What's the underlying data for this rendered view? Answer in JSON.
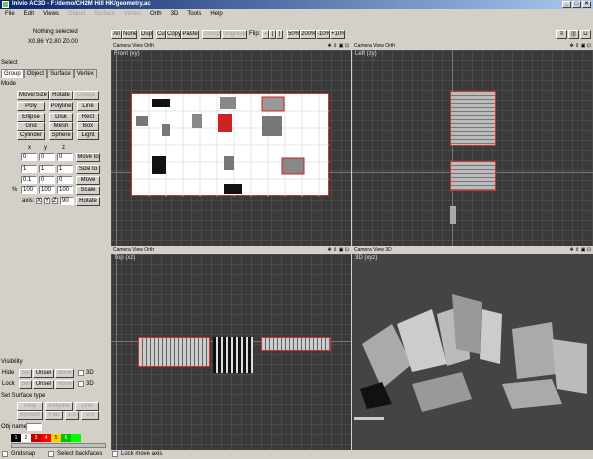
{
  "window": {
    "title": "Inivio AC3D - F:/demo/CH2M Hill HK/geometry.ac",
    "btn_min": "_",
    "btn_max": "□",
    "btn_close": "×"
  },
  "menu": [
    {
      "label": "File",
      "disabled": false
    },
    {
      "label": "Edit",
      "disabled": false
    },
    {
      "label": "Views",
      "disabled": false
    },
    {
      "label": "Object",
      "disabled": true
    },
    {
      "label": "Surface",
      "disabled": true
    },
    {
      "label": "Vertex",
      "disabled": true
    },
    {
      "label": "Orth",
      "disabled": false
    },
    {
      "label": "3D",
      "disabled": false
    },
    {
      "label": "Tools",
      "disabled": false
    },
    {
      "label": "Help",
      "disabled": false
    }
  ],
  "toolbar": {
    "all": "All",
    "none": "None",
    "dup": "Dup",
    "cut": "Cut",
    "copy": "Copy",
    "paste": "Paste",
    "group": "Group",
    "ungroup": "Ungroup",
    "flip": "Flip:",
    "flipx": "-",
    "flipy": "|",
    "flipz": "|",
    "zoom50": "50%",
    "zoom200": "200%",
    "zoomm10": "-10%",
    "zoomp10": "+10%",
    "r1": "≡",
    "r2": "|||",
    "r3": "⊔"
  },
  "left": {
    "selection_info": "Nothing selected",
    "coords": "X0.86 Y2.80 Z0.00",
    "select_label": "Select",
    "tabs": [
      "Group",
      "Object",
      "Surface",
      "Vertex"
    ],
    "mode_label": "Mode",
    "mode_buttons": [
      "Move/Size",
      "Rotate",
      "Create"
    ],
    "create_row1": [
      "Poly",
      "Polyline",
      "Line"
    ],
    "create_row2": [
      "Ellipse",
      "Disk",
      "Rect"
    ],
    "create_row3": [
      "Grid",
      "Mesh",
      "Box"
    ],
    "create_row4": [
      "Cylinder",
      "Sphere",
      "Light"
    ],
    "xyz_heads": [
      "x",
      "y",
      "z"
    ],
    "row_move": {
      "label": "",
      "vals": [
        "0",
        "0",
        "0"
      ],
      "btn": "Move to"
    },
    "row_size": {
      "label": "",
      "vals": [
        "1",
        "1",
        "1"
      ],
      "btn": "Size to"
    },
    "row_move2": {
      "label": "",
      "vals": [
        "0.1",
        "0",
        "0"
      ],
      "btn": "Move"
    },
    "row_scale": {
      "label": "%",
      "vals": [
        "100",
        "100",
        "100"
      ],
      "btn": "Scale"
    },
    "rotate": {
      "axis": "axis:",
      "x": "X",
      "y": "Y",
      "z": "Z",
      "val": "90",
      "btn": "Rotate"
    },
    "visibility_label": "Visibility",
    "hide": {
      "label": "Hide",
      "b1": "Sel",
      "b2": "Unsel",
      "b3": "None",
      "cb": "3D"
    },
    "lock": {
      "label": "Lock",
      "b1": "Sel",
      "b2": "Unsel",
      "b3": "None",
      "cb": "3D"
    },
    "surftype_label": "Set Surface type",
    "surf_row1": [
      "Poly",
      "Polyline",
      "Line"
    ],
    "surf_row2": [
      "Smooth",
      "Flat",
      "1-s",
      "2-s"
    ],
    "objname_label": "Obj name",
    "objname_val": "",
    "palette": [
      {
        "t": "1",
        "c": "#000000"
      },
      {
        "t": "2",
        "c": "#ffffff"
      },
      {
        "t": "3",
        "c": "#c00000"
      },
      {
        "t": "4",
        "c": "#ff0000"
      },
      {
        "t": "5",
        "c": "#ffcc00"
      },
      {
        "t": "6",
        "c": "#00c000"
      },
      {
        "t": "",
        "c": "#00ff00"
      }
    ]
  },
  "viewports": [
    {
      "head": "Camera View Orth",
      "label": "Front (xy)"
    },
    {
      "head": "Camera View Orth",
      "label": "Left (zy)"
    },
    {
      "head": "Camera View Orth",
      "label": "Top (xz)"
    },
    {
      "head": "Camera View 3D",
      "label": "3D (xyz)"
    }
  ],
  "vp_icons": "✥ ⇕ ▣ ⊡",
  "status": {
    "gridsnap": "Gridsnap",
    "selectback": "Select backfaces",
    "lockmove": "Lock move axis"
  }
}
